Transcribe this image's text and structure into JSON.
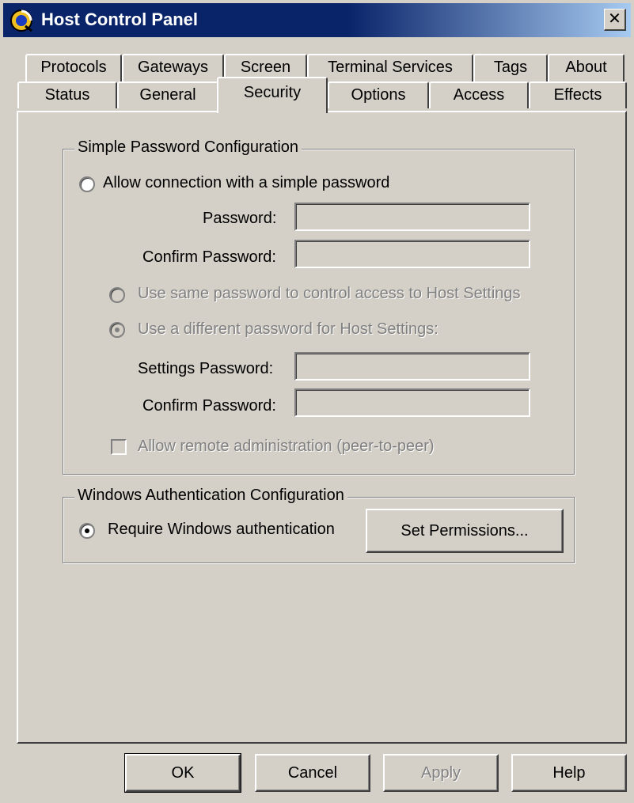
{
  "window": {
    "title": "Host Control Panel",
    "close_glyph": "✕"
  },
  "tabs": {
    "row1": [
      "Protocols",
      "Gateways",
      "Screen",
      "Terminal Services",
      "Tags",
      "About"
    ],
    "row2": [
      "Status",
      "General",
      "Security",
      "Options",
      "Access",
      "Effects"
    ],
    "active": "Security"
  },
  "simple_password": {
    "group_title": "Simple Password Configuration",
    "allow_radio_label": "Allow connection with a simple password",
    "allow_radio_selected": false,
    "password_label": "Password:",
    "password_value": "",
    "confirm_label": "Confirm Password:",
    "confirm_value": "",
    "same_password_label": "Use same password to control access to Host Settings",
    "same_password_selected": false,
    "different_password_label": "Use a different password for Host Settings:",
    "different_password_selected": true,
    "settings_password_label": "Settings Password:",
    "settings_password_value": "",
    "settings_confirm_label": "Confirm Password:",
    "settings_confirm_value": "",
    "remote_admin_label": "Allow remote administration (peer-to-peer)",
    "remote_admin_checked": false
  },
  "windows_auth": {
    "group_title": "Windows Authentication Configuration",
    "require_radio_label": "Require Windows authentication",
    "require_radio_selected": true,
    "set_permissions_label": "Set Permissions..."
  },
  "footer": {
    "ok_label": "OK",
    "cancel_label": "Cancel",
    "apply_label": "Apply",
    "help_label": "Help"
  },
  "colors": {
    "face": "#d4d0c8",
    "title_bar": "#0a246a",
    "disabled_text": "#808080"
  }
}
